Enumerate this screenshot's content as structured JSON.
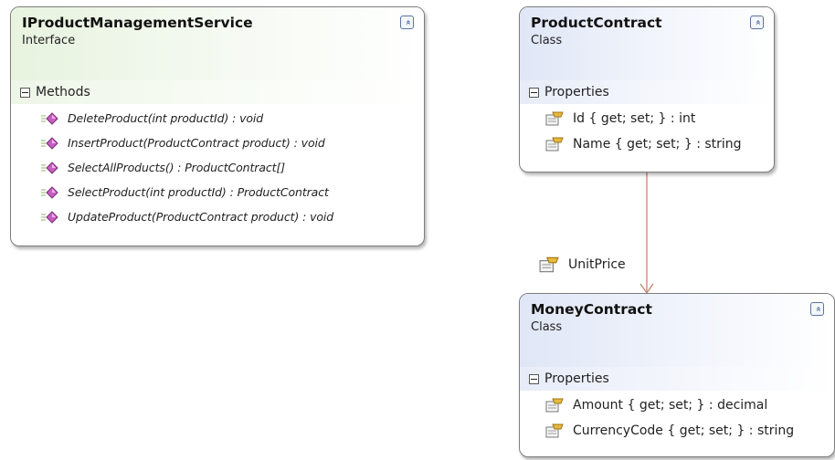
{
  "interface_shape": {
    "title": "IProductManagementService",
    "kind": "Interface",
    "collapse_glyph": "«",
    "section": "Methods",
    "methods": [
      {
        "text": "DeleteProduct(int productId) : void",
        "icon": "method-icon"
      },
      {
        "text": "InsertProduct(ProductContract product) : void",
        "icon": "method-icon"
      },
      {
        "text": "SelectAllProducts() : ProductContract[]",
        "icon": "method-icon"
      },
      {
        "text": "SelectProduct(int productId) : ProductContract",
        "icon": "method-icon"
      },
      {
        "text": "UpdateProduct(ProductContract product) : void",
        "icon": "method-icon"
      }
    ]
  },
  "product_contract": {
    "title": "ProductContract",
    "kind": "Class",
    "collapse_glyph": "«",
    "section": "Properties",
    "properties": [
      {
        "text": "Id { get; set; } : int",
        "icon": "property-icon"
      },
      {
        "text": "Name { get; set; } : string",
        "icon": "property-icon"
      }
    ]
  },
  "money_contract": {
    "title": "MoneyContract",
    "kind": "Class",
    "collapse_glyph": "«",
    "section": "Properties",
    "properties": [
      {
        "text": "Amount { get; set; } : decimal",
        "icon": "property-icon"
      },
      {
        "text": "CurrencyCode { get; set; } : string",
        "icon": "property-icon"
      }
    ]
  },
  "association": {
    "label": "UnitPrice",
    "icon": "property-icon",
    "line_color": "#c8846a"
  }
}
